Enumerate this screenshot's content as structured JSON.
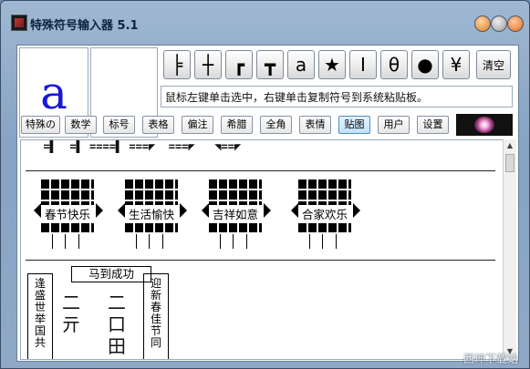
{
  "window": {
    "title": "特殊符号输入器 5.1"
  },
  "preview": {
    "char": "a"
  },
  "symbols": [
    "╞",
    "┼",
    "┏",
    "┳",
    "a",
    "★",
    "Ⅰ",
    "θ",
    "●",
    "¥"
  ],
  "clear_label": "清空",
  "hint": "鼠标左键单击选中，右键单击复制符号到系统粘贴板。",
  "categories": [
    {
      "label": "特殊の"
    },
    {
      "label": "数学"
    },
    {
      "label": "标号"
    },
    {
      "label": "表格"
    },
    {
      "label": "偏注"
    },
    {
      "label": "希腊"
    },
    {
      "label": "全角"
    },
    {
      "label": "表情"
    },
    {
      "label": "贴图"
    },
    {
      "label": "用户"
    },
    {
      "label": "设置"
    }
  ],
  "active_category": "贴图",
  "art": {
    "top_line": "  =▌  =▌ ====▌ ===◤  ===◤   ◥==◤",
    "stamps": [
      "春节快乐",
      "生活愉快",
      "吉祥如意",
      "合家欢乐"
    ],
    "scroll_left": [
      "逢",
      "盛",
      "世",
      "举",
      "国",
      "共"
    ],
    "scroll_right": [
      "迎",
      "新",
      "春",
      "佳",
      "节",
      "同"
    ],
    "banner": "马到成功",
    "mid_glyphs": "二\n亓",
    "mid_glyphs2": "二\n口\n田"
  },
  "watermark": "西坤下载站"
}
